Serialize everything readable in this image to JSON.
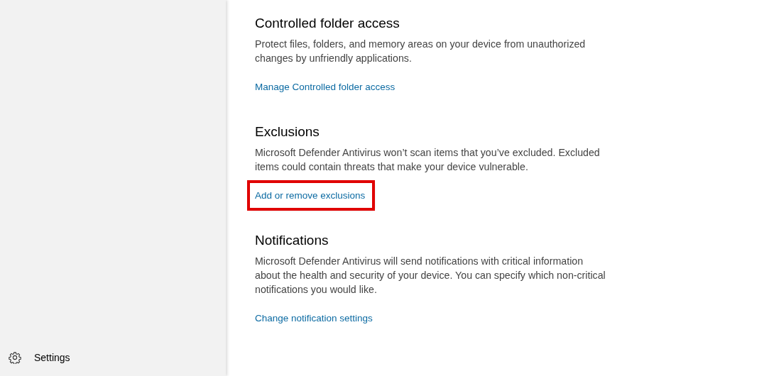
{
  "sidebar": {
    "footer_item": {
      "label": "Settings"
    }
  },
  "sections": [
    {
      "title": "Controlled folder access",
      "description": "Protect files, folders, and memory areas on your device from unauthorized changes by unfriendly applications.",
      "link": "Manage Controlled folder access",
      "highlighted": false
    },
    {
      "title": "Exclusions",
      "description": "Microsoft Defender Antivirus won’t scan items that you’ve excluded. Excluded items could contain threats that make your device vulnerable.",
      "link": "Add or remove exclusions",
      "highlighted": true
    },
    {
      "title": "Notifications",
      "description": "Microsoft Defender Antivirus will send notifications with critical information about the health and security of your device. You can specify which non-critical notifications you would like.",
      "link": "Change notification settings",
      "highlighted": false
    }
  ]
}
